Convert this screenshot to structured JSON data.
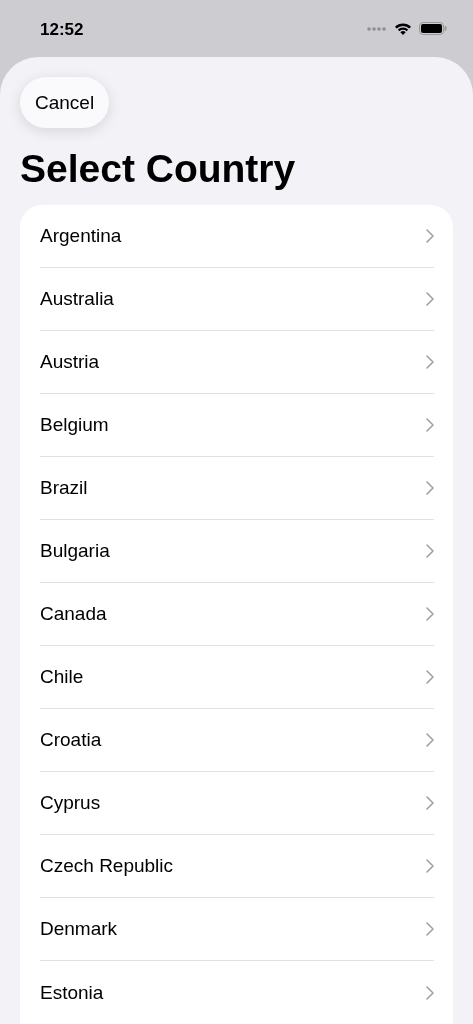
{
  "status_bar": {
    "time": "12:52"
  },
  "cancel_button": {
    "label": "Cancel"
  },
  "title": "Select Country",
  "countries": [
    {
      "name": "Argentina"
    },
    {
      "name": "Australia"
    },
    {
      "name": "Austria"
    },
    {
      "name": "Belgium"
    },
    {
      "name": "Brazil"
    },
    {
      "name": "Bulgaria"
    },
    {
      "name": "Canada"
    },
    {
      "name": "Chile"
    },
    {
      "name": "Croatia"
    },
    {
      "name": "Cyprus"
    },
    {
      "name": "Czech Republic"
    },
    {
      "name": "Denmark"
    },
    {
      "name": "Estonia"
    }
  ]
}
